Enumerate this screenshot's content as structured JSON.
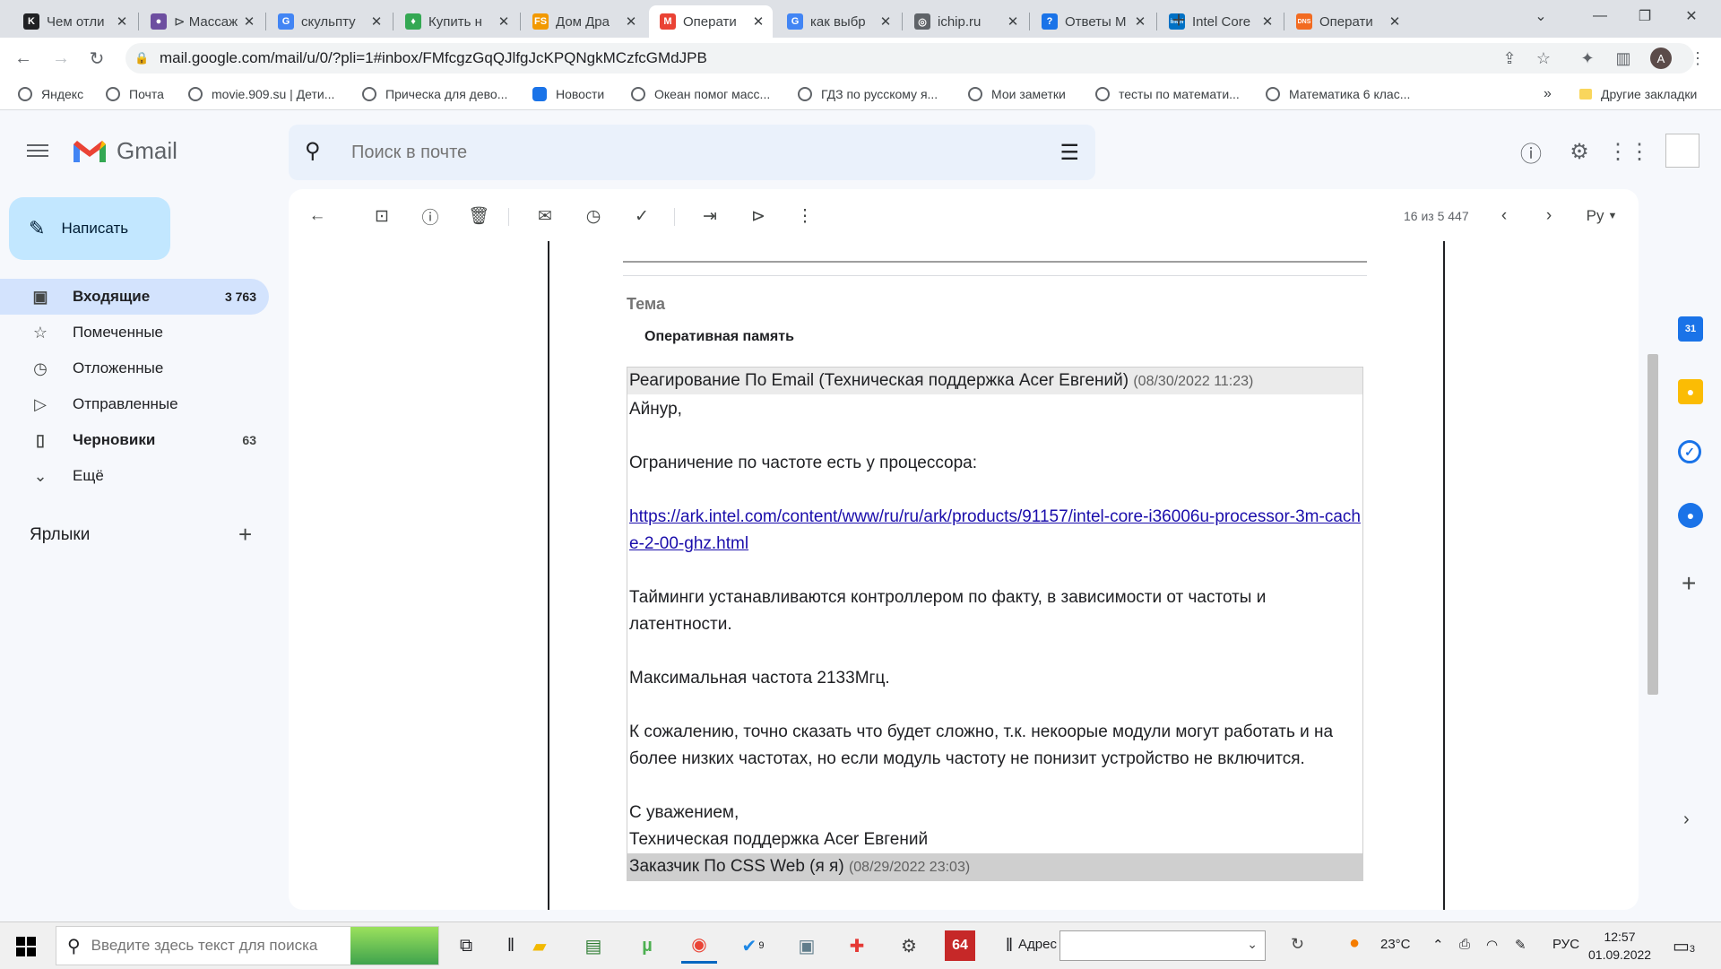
{
  "browser": {
    "tabs": [
      {
        "title": "Чем отли",
        "fav": "K",
        "fav_color": "#202124",
        "active": false
      },
      {
        "title": "⊳ Массаж",
        "fav": "●",
        "fav_color": "#6d4ea0",
        "active": false
      },
      {
        "title": "скульпту",
        "fav": "G",
        "fav_color": "#4285f4",
        "active": false
      },
      {
        "title": "Купить н",
        "fav": "♦",
        "fav_color": "#34a853",
        "active": false
      },
      {
        "title": "Дом Дра",
        "fav": "FS",
        "fav_color": "#f29900",
        "active": false
      },
      {
        "title": "Операти",
        "fav": "M",
        "fav_color": "#ea4335",
        "active": true
      },
      {
        "title": "как выбр",
        "fav": "G",
        "fav_color": "#4285f4",
        "active": false
      },
      {
        "title": "ichip.ru",
        "fav": "◎",
        "fav_color": "#5f6368",
        "active": false
      },
      {
        "title": "Ответы М",
        "fav": "?",
        "fav_color": "#1a73e8",
        "active": false
      },
      {
        "title": "Intel Core",
        "fav": "intel",
        "fav_color": "#0071c5",
        "active": false
      },
      {
        "title": "Операти",
        "fav": "DNS",
        "fav_color": "#f26b21",
        "active": false
      }
    ],
    "new_tab": "+",
    "url": "mail.google.com/mail/u/0/?pli=1#inbox/FMfcgzGqQJlfgJcKPQNgkMCzfcGMdJPB",
    "profile_initial": "A",
    "bookmarks": [
      "Яндекс",
      "Почта",
      "movie.909.su | Дети...",
      "Прическа для дево...",
      "Новости",
      "Океан помог масс...",
      "ГДЗ по русскому я...",
      "Мои заметки",
      "тесты по математи...",
      "Математика 6 клас..."
    ],
    "bookmarks_more": "»",
    "other_bookmarks": "Другие закладки"
  },
  "gmail": {
    "logo_text": "Gmail",
    "search_placeholder": "Поиск в почте",
    "compose_label": "Написать",
    "folders": [
      {
        "label": "Входящие",
        "count": "3 763",
        "icon": "inbox-icon",
        "glyph": "▣",
        "selected": true
      },
      {
        "label": "Помеченные",
        "count": "",
        "icon": "star-icon",
        "glyph": "☆",
        "selected": false
      },
      {
        "label": "Отложенные",
        "count": "",
        "icon": "clock-icon",
        "glyph": "◷",
        "selected": false
      },
      {
        "label": "Отправленные",
        "count": "",
        "icon": "send-icon",
        "glyph": "▷",
        "selected": false
      },
      {
        "label": "Черновики",
        "count": "63",
        "icon": "draft-icon",
        "glyph": "▯",
        "selected": false,
        "bold": true
      },
      {
        "label": "Ещё",
        "count": "",
        "icon": "chevron-down-icon",
        "glyph": "⌄",
        "selected": false
      }
    ],
    "labels_title": "Ярлыки",
    "pager": "16 из 5 447",
    "lang_button": "Ру",
    "email": {
      "subject_label": "Тема",
      "subject": "Оперативная память",
      "messages": [
        {
          "from": "Реагирование По Email (Техническая поддержка Acer Евгений)",
          "date": "(08/30/2022 11:23)",
          "greeting": "Айнур,",
          "p1": "Ограничение по частоте есть у процессора:",
          "link": "https://ark.intel.com/content/www/ru/ru/ark/products/91157/intel-core-i36006u-processor-3m-cache-2-00-ghz.html",
          "p2": "Тайминги устанавливаются контроллером по факту, в зависимости от частоты и латентности.",
          "p3": "Максимальная частота 2133Мгц.",
          "p4": "К сожалению, точно сказать что будет сложно, т.к. некоорые модули могут работать и на более низких частотах, но если модуль частоту не понизит устройство не включится.",
          "sign1": "С уважением,",
          "sign2": "Техническая поддержка Acer Евгений"
        },
        {
          "from": "Заказчик По CSS Web (я я)",
          "date": "(08/29/2022 23:03)"
        }
      ]
    }
  },
  "taskbar": {
    "search_placeholder": "Введите здесь текст для поиска",
    "address_label": "Адрес",
    "badge_9": "9",
    "badge_64": "64",
    "weather": "23°C",
    "lang": "РУС",
    "time": "12:57",
    "date": "01.09.2022",
    "notif_count": "3"
  }
}
